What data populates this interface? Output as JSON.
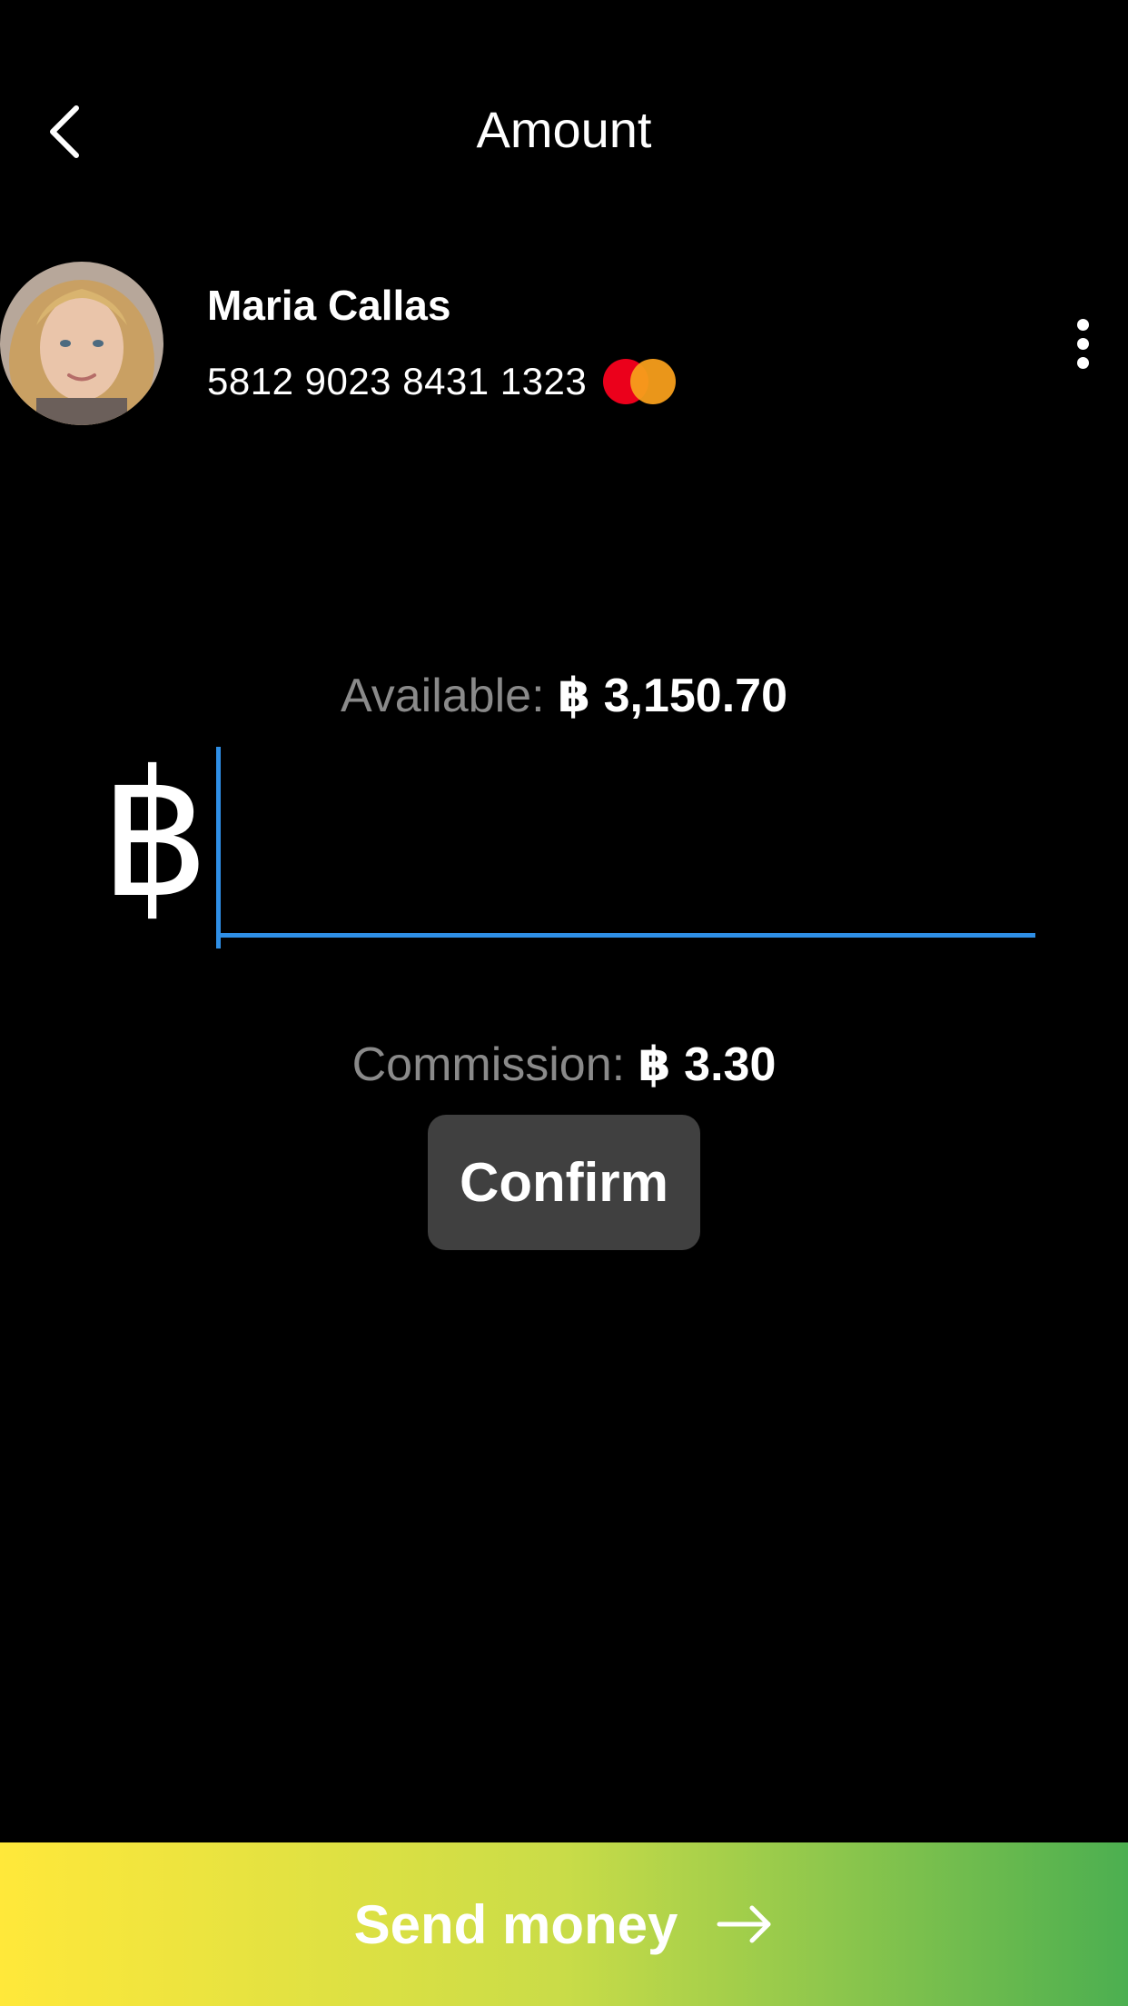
{
  "header": {
    "title": "Amount",
    "back_icon": "chevron-left-icon"
  },
  "contact": {
    "name": "Maria Callas",
    "card_number": "5812 9023 8431 1323",
    "card_brand_icon": "mastercard-logo-icon",
    "more_icon": "more-vertical-icon"
  },
  "balance": {
    "available_label": "Available:",
    "available_value": "฿ 3,150.70"
  },
  "amount": {
    "currency_symbol": "฿",
    "value": "",
    "placeholder": ""
  },
  "commission": {
    "label": "Commission:",
    "value": "฿ 3.30"
  },
  "actions": {
    "confirm_label": "Confirm",
    "send_label": "Send money",
    "send_icon": "arrow-right-icon"
  },
  "colors": {
    "background": "#000000",
    "accent_blue": "#2f8fe6",
    "muted_text": "#8a8a8a",
    "confirm_bg": "#404040",
    "gradient_start": "#ffe83a",
    "gradient_end": "#4caf50"
  }
}
